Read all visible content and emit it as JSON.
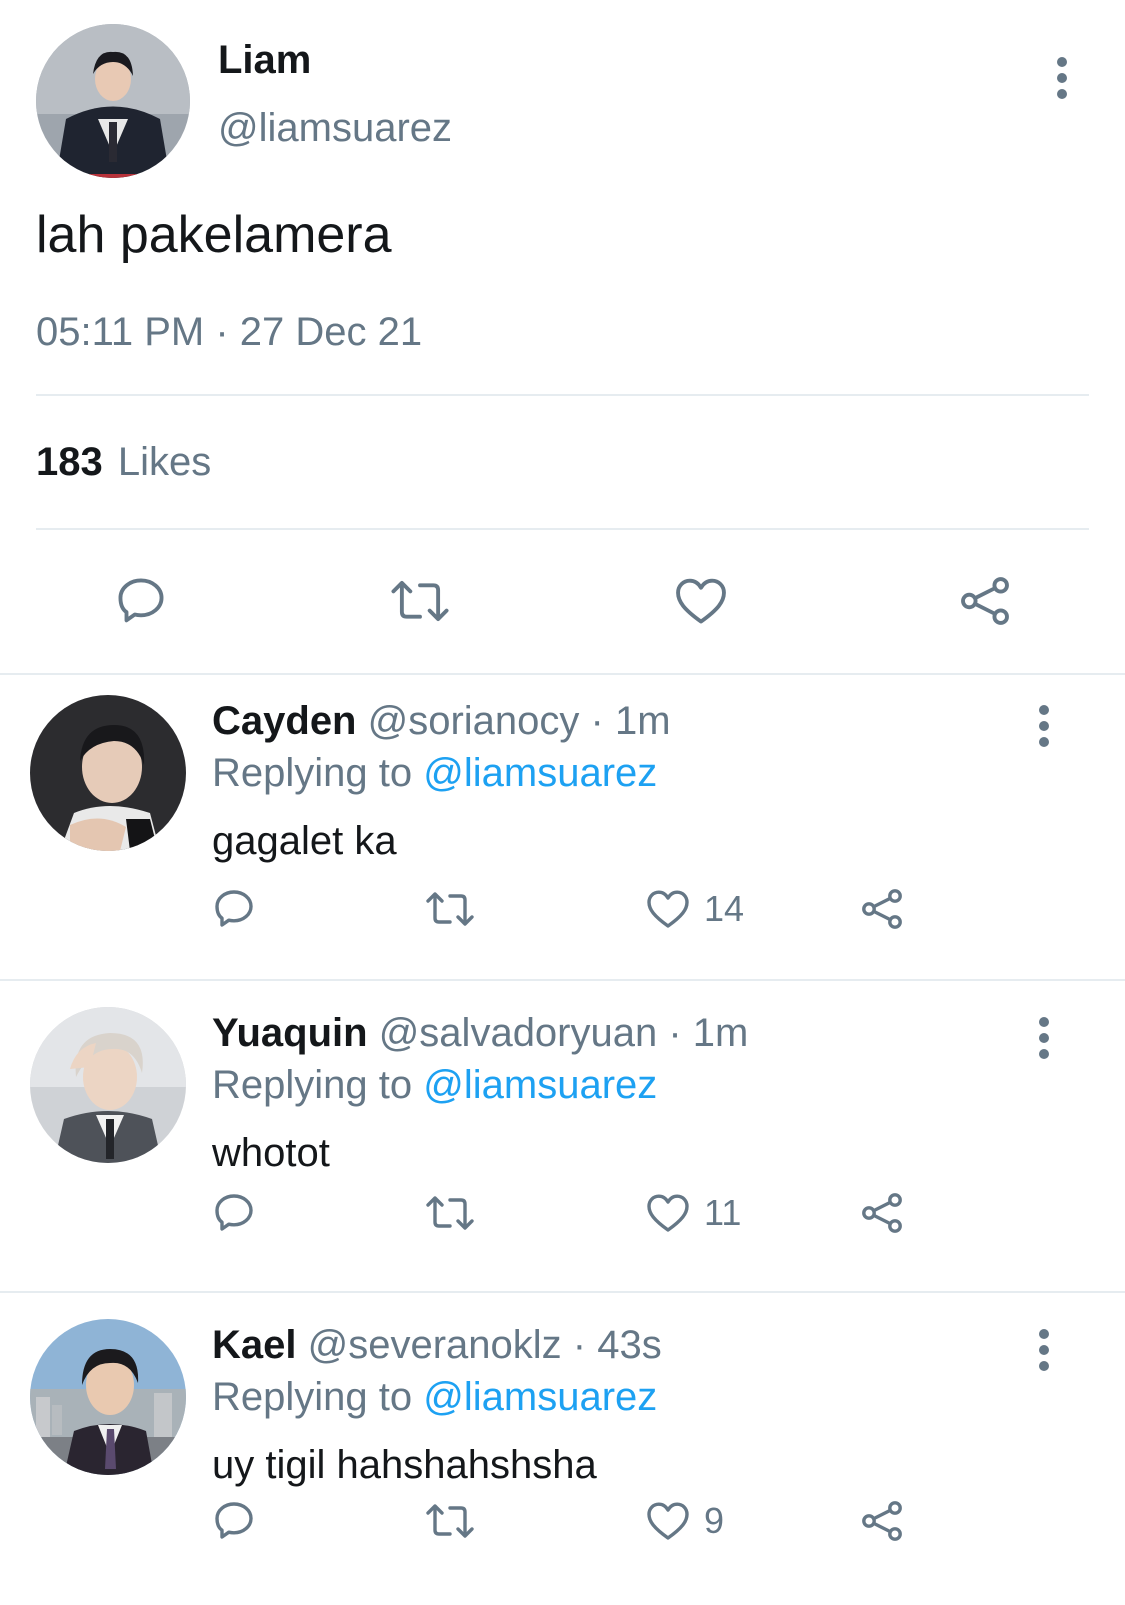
{
  "main_tweet": {
    "name": "Liam",
    "handle": "@liamsuarez",
    "text": "lah pakelamera",
    "timestamp": "05:11 PM · 27 Dec 21",
    "likes_count": "183",
    "likes_label": "Likes"
  },
  "replies": [
    {
      "name": "Cayden",
      "handle": "@sorianocy",
      "time": "· 1m",
      "replying_prefix": "Replying to",
      "replying_to": "@liamsuarez",
      "text": "gagalet ka",
      "likes": "14"
    },
    {
      "name": "Yuaquin",
      "handle": "@salvadoryuan",
      "time": "· 1m",
      "replying_prefix": "Replying to",
      "replying_to": "@liamsuarez",
      "text": "whotot",
      "likes": "11"
    },
    {
      "name": "Kael",
      "handle": "@severanoklz",
      "time": "· 43s",
      "replying_prefix": "Replying to",
      "replying_to": "@liamsuarez",
      "text": "uy tigil hahshahshsha",
      "likes": "9"
    }
  ],
  "icons": {
    "reply": "speech-bubble-icon",
    "retweet": "retweet-icon",
    "like": "heart-icon",
    "share": "share-icon",
    "more": "vertical-dots-icon"
  },
  "colors": {
    "accent": "#1da1f2",
    "secondary_text": "#657786",
    "divider": "#e6ecf0"
  }
}
